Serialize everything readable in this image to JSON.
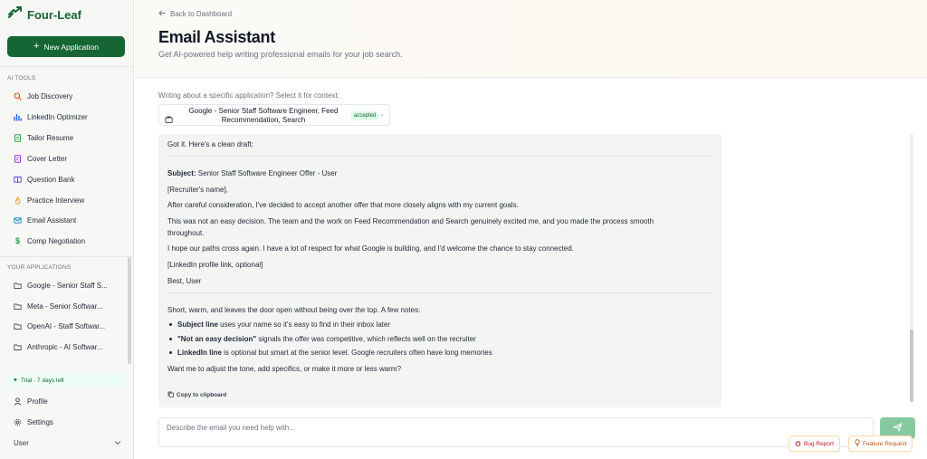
{
  "app": {
    "name": "Four-Leaf"
  },
  "sidebar": {
    "new_button": "New Application",
    "ai_tools_label": "AI TOOLS",
    "tools": [
      {
        "label": "Job Discovery",
        "icon": "search-icon"
      },
      {
        "label": "LinkedIn Optimizer",
        "icon": "bar-chart-icon"
      },
      {
        "label": "Tailor Resume",
        "icon": "document-icon"
      },
      {
        "label": "Cover Letter",
        "icon": "file-text-icon"
      },
      {
        "label": "Question Bank",
        "icon": "book-icon"
      },
      {
        "label": "Practice Interview",
        "icon": "flame-icon"
      },
      {
        "label": "Email Assistant",
        "icon": "mail-icon"
      },
      {
        "label": "Comp Negotiation",
        "icon": "dollar-icon"
      }
    ],
    "applications_label": "YOUR APPLICATIONS",
    "applications": [
      {
        "label": "Google - Senior Staff S..."
      },
      {
        "label": "Meta - Senior Softwar..."
      },
      {
        "label": "OpenAI - Staff Softwar..."
      },
      {
        "label": "Anthropic - AI Softwar..."
      }
    ],
    "trial": "Trial · 7 days left",
    "profile": "Profile",
    "settings": "Settings",
    "user": "User"
  },
  "header": {
    "back": "Back to Dashboard",
    "title": "Email Assistant",
    "subtitle": "Get AI-powered help writing professional emails for your job search."
  },
  "context": {
    "label": "Writing about a specific application? Select it for context:",
    "selected": "Google - Senior Staff Software Engineer, Feed Recommendation, Search",
    "badge": "accepted"
  },
  "message": {
    "intro": "Got it. Here's a clean draft:",
    "subject_label": "Subject:",
    "subject": "Senior Staff Software Engineer Offer - User",
    "greeting": "[Recruiter's name],",
    "p1": "After careful consideration, I've decided to accept another offer that more closely aligns with my current goals.",
    "p2a": "This was not an easy decision. The team and the work on Feed Recommendation and Search genuinely excited me, and you made the process smooth",
    "p2b": "throughout.",
    "p3": "I hope our paths cross again. I have a lot of respect for what Google is building, and I'd welcome the chance to stay connected.",
    "linkedin": "[LinkedIn profile link, optional]",
    "signoff": "Best, User",
    "notes_intro": "Short, warm, and leaves the door open without being over the top. A few notes:",
    "notes": [
      {
        "bold": "Subject line",
        "text": "uses your name so it's easy to find in their inbox later"
      },
      {
        "bold": "\"Not an easy decision\"",
        "text": "signals the offer was competitive, which reflects well on the recruiter"
      },
      {
        "bold": "LinkedIn line",
        "text": "is optional but smart at the senior level. Google recruiters often have long memories"
      }
    ],
    "closing": "Want me to adjust the tone, add specifics, or make it more or less warm?",
    "copy": "Copy to clipboard"
  },
  "composer": {
    "placeholder": "Describe the email you need help with..."
  },
  "floating": {
    "bug": "Bug Report",
    "feature": "Feature Request"
  },
  "colors": {
    "brand": "#166534",
    "accent_light": "#dcfce7",
    "send": "#86c9a0"
  }
}
